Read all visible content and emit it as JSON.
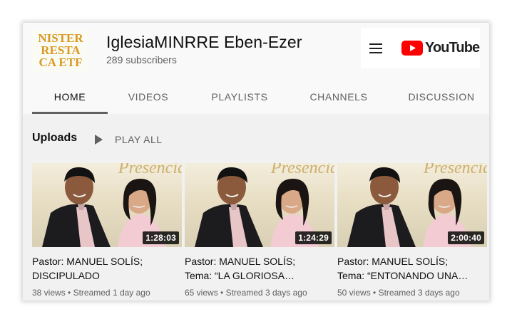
{
  "channel": {
    "avatar_text": [
      "NISTER",
      "RESTA",
      "CA ETF"
    ],
    "name": "IglesiaMINRRE Eben-Ezer",
    "subscribers": "289 subscribers"
  },
  "topbar": {
    "menu_icon": "hamburger-menu-icon",
    "logo_wordmark": "YouTube",
    "logo_color": "#ff0000"
  },
  "tabs": [
    {
      "label": "HOME",
      "active": true
    },
    {
      "label": "VIDEOS",
      "active": false
    },
    {
      "label": "PLAYLISTS",
      "active": false
    },
    {
      "label": "CHANNELS",
      "active": false
    },
    {
      "label": "DISCUSSION",
      "active": false
    }
  ],
  "uploads": {
    "title": "Uploads",
    "play_all_label": "PLAY ALL",
    "play_icon": "play-icon"
  },
  "videos": [
    {
      "thumbnail_text": "Presencia",
      "duration": "1:28:03",
      "title_line1": "Pastor: MANUEL SOLÍS;",
      "title_line2": "DISCIPULADO",
      "views": "38 views",
      "separator": "•",
      "streamed": "Streamed 1 day ago"
    },
    {
      "thumbnail_text": "Presencia",
      "duration": "1:24:29",
      "title_line1": "Pastor: MANUEL SOLÍS;",
      "title_line2": "Tema: “LA GLORIOSA…",
      "views": "65 views",
      "separator": "•",
      "streamed": "Streamed 3 days ago"
    },
    {
      "thumbnail_text": "Presencia",
      "duration": "2:00:40",
      "title_line1": "Pastor: MANUEL SOLÍS;",
      "title_line2": "Tema: “ENTONANDO UNA…",
      "views": "50 views",
      "separator": "•",
      "streamed": "Streamed 3 days ago"
    }
  ]
}
